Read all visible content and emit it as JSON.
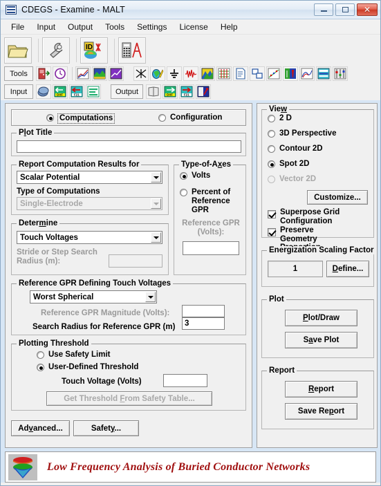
{
  "window": {
    "title": "CDEGS - Examine - MALT",
    "icon": "grid-icon",
    "buttons": {
      "minimize": "–",
      "maximize": "❐",
      "close": "✕"
    }
  },
  "menu": {
    "items": [
      "File",
      "Input",
      "Output",
      "Tools",
      "Settings",
      "License",
      "Help"
    ]
  },
  "toolbar": {
    "big_buttons": [
      "open-folder-icon",
      "wrench-icon",
      "id-plot-icon",
      "calculator-compass-icon"
    ],
    "tools_label": "Tools",
    "tools_icons": [
      "door-exit-icon",
      "clock-icon",
      "line-graph-icon",
      "terrain-plot-icon",
      "purple-plot-icon",
      "crossed-arrows-icon",
      "globe-pen-icon",
      "ground-symbol-icon",
      "waveform-icon",
      "contour-plot-icon",
      "mesh-icon",
      "document-icon",
      "windows-icon",
      "scatter-plot-icon",
      "tower-icon",
      "trace-icon",
      "table-icon",
      "sliders-icon"
    ],
    "input_label": "Input",
    "input_icons": [
      "layers-icon",
      "input-dxf-icon",
      "input-f21-icon",
      "input-list-icon"
    ],
    "output_label": "Output",
    "output_icons": [
      "book-icon",
      "output-dxf-icon",
      "output-f21-icon",
      "output-chart-icon"
    ]
  },
  "mode_selector": {
    "computations": {
      "label": "Computations",
      "selected": true
    },
    "configuration": {
      "label": "Configuration",
      "selected": false
    }
  },
  "plot_title": {
    "legend": "Plot Title",
    "value": "",
    "accel": "l"
  },
  "report_computation": {
    "legend": "Report Computation Results for",
    "selected": "Scalar Potential",
    "type_label": "Type of Computations",
    "type_value": "Single-Electrode",
    "type_disabled": true
  },
  "determine": {
    "legend": "Determine",
    "accel": "m",
    "selected": "Touch Voltages",
    "stride_label": "Stride or Step Search Radius (m):",
    "stride_value": "",
    "stride_disabled": true
  },
  "type_of_axes": {
    "legend": "Type-of-Axes",
    "accel": "x",
    "options": [
      {
        "label": "Volts",
        "selected": true
      },
      {
        "label": "Percent of Reference GPR",
        "selected": false
      }
    ],
    "reference_gpr_label": "Reference GPR (Volts):",
    "reference_gpr_value": "",
    "reference_gpr_disabled": true
  },
  "reference_gpr_group": {
    "legend": "Reference GPR Defining Touch Voltages",
    "selected": "Worst Spherical",
    "magnitude_label": "Reference GPR Magnitude (Volts):",
    "magnitude_value": "",
    "magnitude_disabled": true,
    "search_radius_label": "Search Radius for Reference GPR (m)",
    "search_radius_value": "3"
  },
  "plotting_threshold": {
    "legend": "Plotting Threshold",
    "options": [
      {
        "label": "Use Safety Limit",
        "selected": false
      },
      {
        "label": "User-Defined Threshold",
        "selected": true
      }
    ],
    "touch_voltage_label": "Touch Voltage   (Volts)",
    "touch_voltage_value": "",
    "get_threshold_button": "Get Threshold From Safety Table...",
    "get_threshold_accel": "F",
    "get_threshold_disabled": true
  },
  "bottom_buttons": [
    {
      "label": "Advanced...",
      "accel": "v"
    },
    {
      "label": "Safety...",
      "accel": "y"
    }
  ],
  "view": {
    "legend": "View",
    "accel": "w",
    "options": [
      {
        "label": "2 D",
        "selected": false,
        "disabled": false
      },
      {
        "label": "3D Perspective",
        "selected": false,
        "disabled": false
      },
      {
        "label": "Contour 2D",
        "selected": false,
        "disabled": false
      },
      {
        "label": "Spot 2D",
        "selected": true,
        "disabled": false
      },
      {
        "label": "Vector 2D",
        "selected": false,
        "disabled": true
      }
    ],
    "customize_button": "Customize...",
    "checkboxes": [
      {
        "label": "Superpose Grid Configuration",
        "checked": true
      },
      {
        "label": "Preserve Geometry Proportion",
        "checked": true
      }
    ]
  },
  "energization": {
    "legend": "Energization Scaling Factor",
    "value": "1",
    "define_button": "Define...",
    "define_accel": "D"
  },
  "plot": {
    "legend": "Plot",
    "buttons": [
      {
        "label": "Plot/Draw",
        "accel": "P"
      },
      {
        "label": "Save Plot",
        "accel": "a"
      }
    ]
  },
  "report": {
    "legend": "Report",
    "buttons": [
      {
        "label": "Report",
        "accel": "R"
      },
      {
        "label": "Save Report",
        "accel": "p"
      }
    ]
  },
  "footer": {
    "logo": "surface-plot-icon",
    "text": "Low Frequency Analysis of Buried Conductor Networks"
  },
  "colors": {
    "window_bg": "#f0f0f0",
    "content_bg": "#d7e6f5",
    "footer_text": "#a01010",
    "title_gradient_top": "#f2f6fb",
    "close_button": "#cc3a25"
  }
}
